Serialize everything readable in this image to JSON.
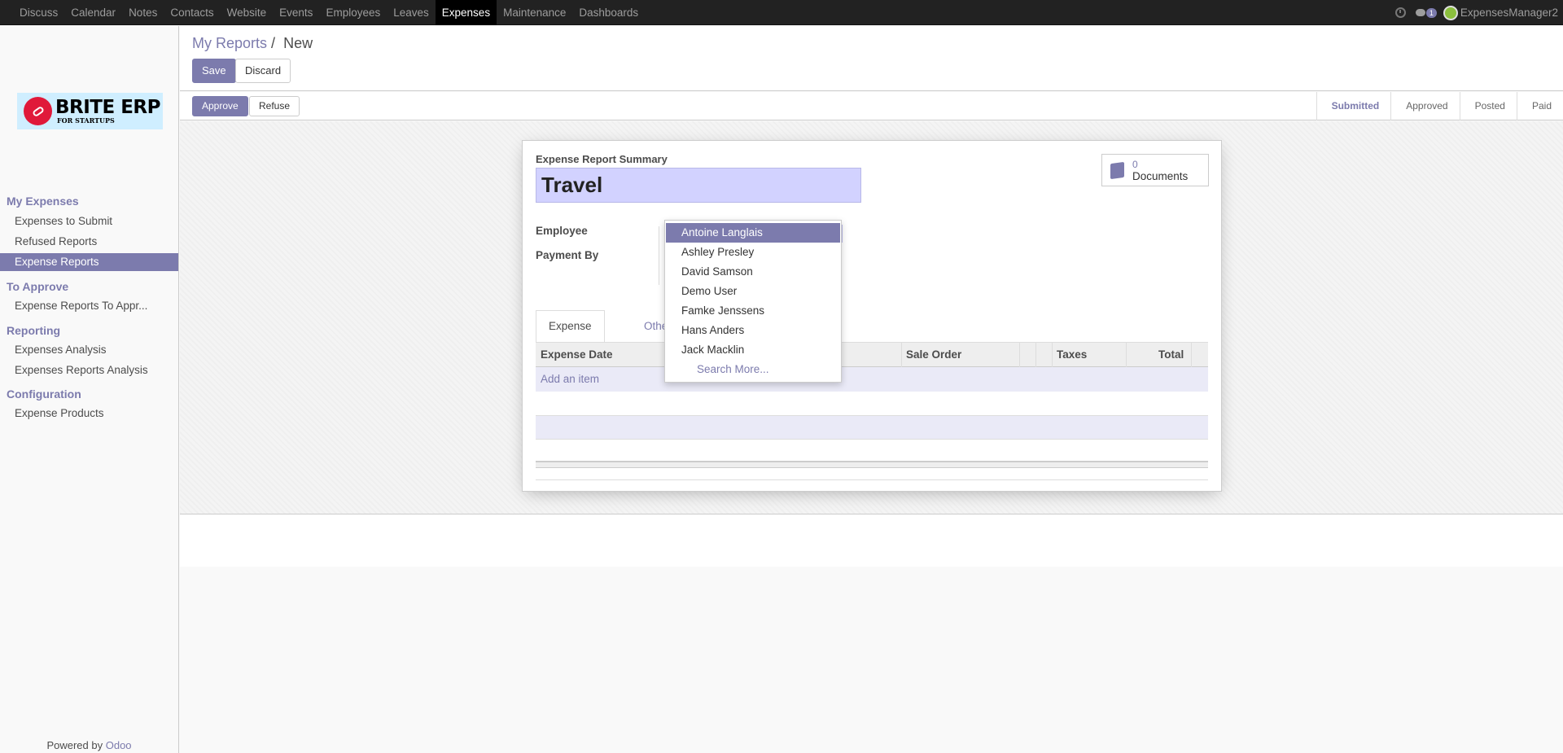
{
  "topbar": {
    "menu": [
      "Discuss",
      "Calendar",
      "Notes",
      "Contacts",
      "Website",
      "Events",
      "Employees",
      "Leaves",
      "Expenses",
      "Maintenance",
      "Dashboards"
    ],
    "active": "Expenses",
    "chat_count": "1",
    "user": "ExpensesManager2"
  },
  "logo": {
    "main": "BRITE ERP",
    "sub": "FOR STARTUPS"
  },
  "sidebar": {
    "sections": [
      {
        "title": "My Expenses",
        "items": [
          "Expenses to Submit",
          "Refused Reports",
          "Expense Reports"
        ]
      },
      {
        "title": "To Approve",
        "items": [
          "Expense Reports To Appr..."
        ]
      },
      {
        "title": "Reporting",
        "items": [
          "Expenses Analysis",
          "Expenses Reports Analysis"
        ]
      },
      {
        "title": "Configuration",
        "items": [
          "Expense Products"
        ]
      }
    ],
    "active_item": "Expense Reports",
    "powered_prefix": "Powered by",
    "powered_brand": "Odoo"
  },
  "breadcrumb": {
    "parent": "My Reports",
    "separator": "/",
    "current": "New"
  },
  "actions": {
    "save": "Save",
    "discard": "Discard"
  },
  "statusbar": {
    "approve": "Approve",
    "refuse": "Refuse",
    "stages": [
      "Submitted",
      "Approved",
      "Posted",
      "Paid"
    ],
    "current": "Submitted"
  },
  "form": {
    "summary_label": "Expense Report Summary",
    "summary_value": "Travel",
    "documents_count": "0",
    "documents_label": "Documents",
    "employee_label": "Employee",
    "payment_label": "Payment By",
    "tabs": [
      "Expense Lines",
      "Other Info"
    ],
    "columns": [
      "Expense Date",
      "Sale Order",
      "Taxes",
      "Total"
    ],
    "add_item": "Add an item"
  },
  "autocomplete": {
    "options": [
      "Antoine Langlais",
      "Ashley Presley",
      "David Samson",
      "Demo User",
      "Famke Jenssens",
      "Hans Anders",
      "Jack Macklin"
    ],
    "highlighted": "Antoine Langlais",
    "search_more": "Search More..."
  },
  "colors": {
    "accent": "#7c7bad",
    "navbar": "#222222",
    "input_required": "#d2d2ff"
  }
}
